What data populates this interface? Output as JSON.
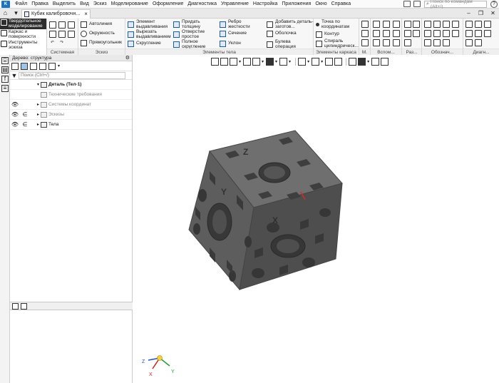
{
  "menu": {
    "items": [
      "Файл",
      "Правка",
      "Выделить",
      "Вид",
      "Эскиз",
      "Моделирование",
      "Оформление",
      "Диагностика",
      "Управление",
      "Настройка",
      "Приложения",
      "Окно",
      "Справка"
    ],
    "search_placeholder": "Поиск по командам (Alt+/)",
    "help": "?"
  },
  "tabs": {
    "document_title": "Кубик калибровочн...",
    "close": "×"
  },
  "window_controls": [
    "–",
    "❐",
    "✕"
  ],
  "modes": [
    {
      "label": "Твердотельное моделирование",
      "active": true
    },
    {
      "label": "Каркас и поверхности",
      "active": false
    },
    {
      "label": "Инструменты эскиза",
      "active": false
    }
  ],
  "ribbon": {
    "groups": {
      "system": "Системная",
      "sketch": "Эскиз",
      "body_elements": "Элементы тела",
      "frame_elements": "Элементы каркаса",
      "m": "М.",
      "aux": "Вспом...",
      "sizes": "Раз...",
      "notation": "Обознач...",
      "diag": "Диагн..."
    },
    "sketch": [
      "Автолиния",
      "Окружность",
      "Прямоугольник"
    ],
    "body": {
      "col1": [
        "Элемент выдавливания",
        "Вырезать выдавливанием",
        "Скругление"
      ],
      "col2": [
        "Придать толщину",
        "Отверстие простое",
        "Полное скругление"
      ],
      "col3": [
        "Ребро жесткости",
        "Сечение",
        "Уклон"
      ],
      "col4": [
        "Добавить деталь-заготов...",
        "Оболочка",
        "Булева операция"
      ]
    },
    "frame": [
      "Точка по координатам",
      "Контур",
      "Спираль цилиндрическ..."
    ]
  },
  "tree": {
    "header": "Дерево: структура",
    "gear": "⚙",
    "search_placeholder": "Поиск (Ctrl+/)",
    "rows": [
      {
        "label": "Деталь (Тел-1)",
        "expand": "▾",
        "eye": "",
        "elem": ""
      },
      {
        "label": "Технические требования",
        "expand": "",
        "eye": "",
        "elem": ""
      },
      {
        "label": "Системы координат",
        "expand": "▸",
        "eye": "👁",
        "elem": ""
      },
      {
        "label": "Эскизы",
        "expand": "▸",
        "eye": "👁",
        "elem": "∈"
      },
      {
        "label": "Тела",
        "expand": "▸",
        "eye": "👁",
        "elem": "∈"
      }
    ]
  },
  "triad": {
    "x": "X",
    "y": "Y",
    "z": "Z"
  },
  "cube_labels": {
    "top": "Z",
    "front": "X",
    "side": "Y"
  },
  "colors": {
    "accent": "#1e73be",
    "cube_top": "#6e6e6e",
    "cube_left": "#5a5a5a",
    "cube_right": "#4d4d4d"
  }
}
